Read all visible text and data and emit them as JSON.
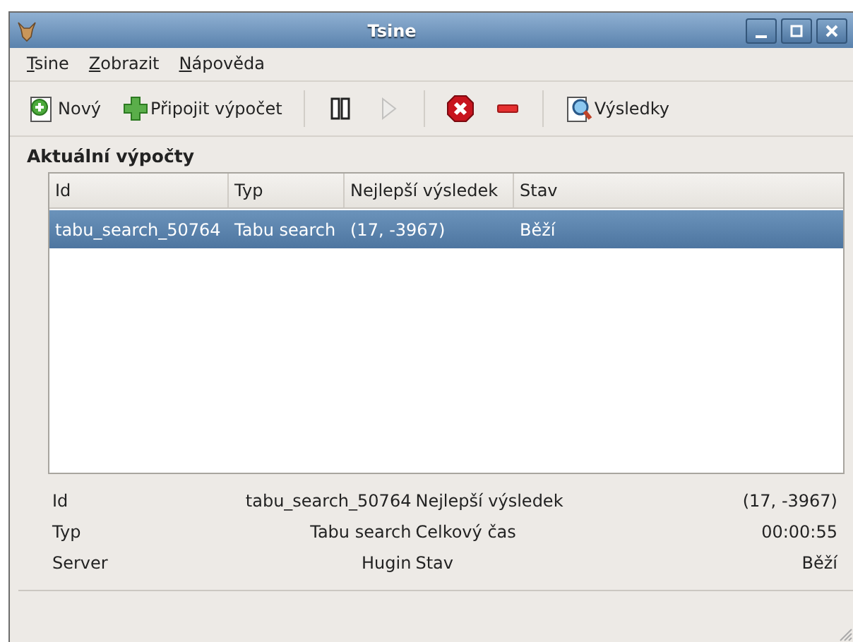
{
  "window": {
    "title": "Tsine"
  },
  "menu": [
    {
      "label": "Tsine"
    },
    {
      "label": "Zobrazit"
    },
    {
      "label": "Nápověda"
    }
  ],
  "toolbar": [
    {
      "kind": "new",
      "label": "Nový",
      "disabled": false
    },
    {
      "kind": "connect",
      "label": "Připojit výpočet",
      "disabled": false
    },
    {
      "kind": "separator"
    },
    {
      "kind": "pause",
      "disabled": false
    },
    {
      "kind": "play",
      "disabled": true
    },
    {
      "kind": "separator"
    },
    {
      "kind": "stop",
      "disabled": false
    },
    {
      "kind": "remove",
      "disabled": false
    },
    {
      "kind": "separator"
    },
    {
      "kind": "results",
      "label": "Výsledky",
      "disabled": false
    }
  ],
  "section": {
    "title": "Aktuální výpočty"
  },
  "table": {
    "columns": [
      "Id",
      "Typ",
      "Nejlepší výsledek",
      "Stav"
    ],
    "rows": [
      {
        "cells": [
          "tabu_search_50764",
          "Tabu search",
          "(17, -3967)",
          "Běží"
        ],
        "selected": true
      }
    ]
  },
  "details": [
    {
      "label": "Id",
      "value": "tabu_search_50764",
      "label2": "Nejlepší výsledek",
      "value2": "(17, -3967)"
    },
    {
      "label": "Typ",
      "value": "Tabu search",
      "label2": "Celkový čas",
      "value2": "00:00:55"
    },
    {
      "label": "Server",
      "value": "Hugin",
      "label2": "Stav",
      "value2": "Běží"
    }
  ]
}
